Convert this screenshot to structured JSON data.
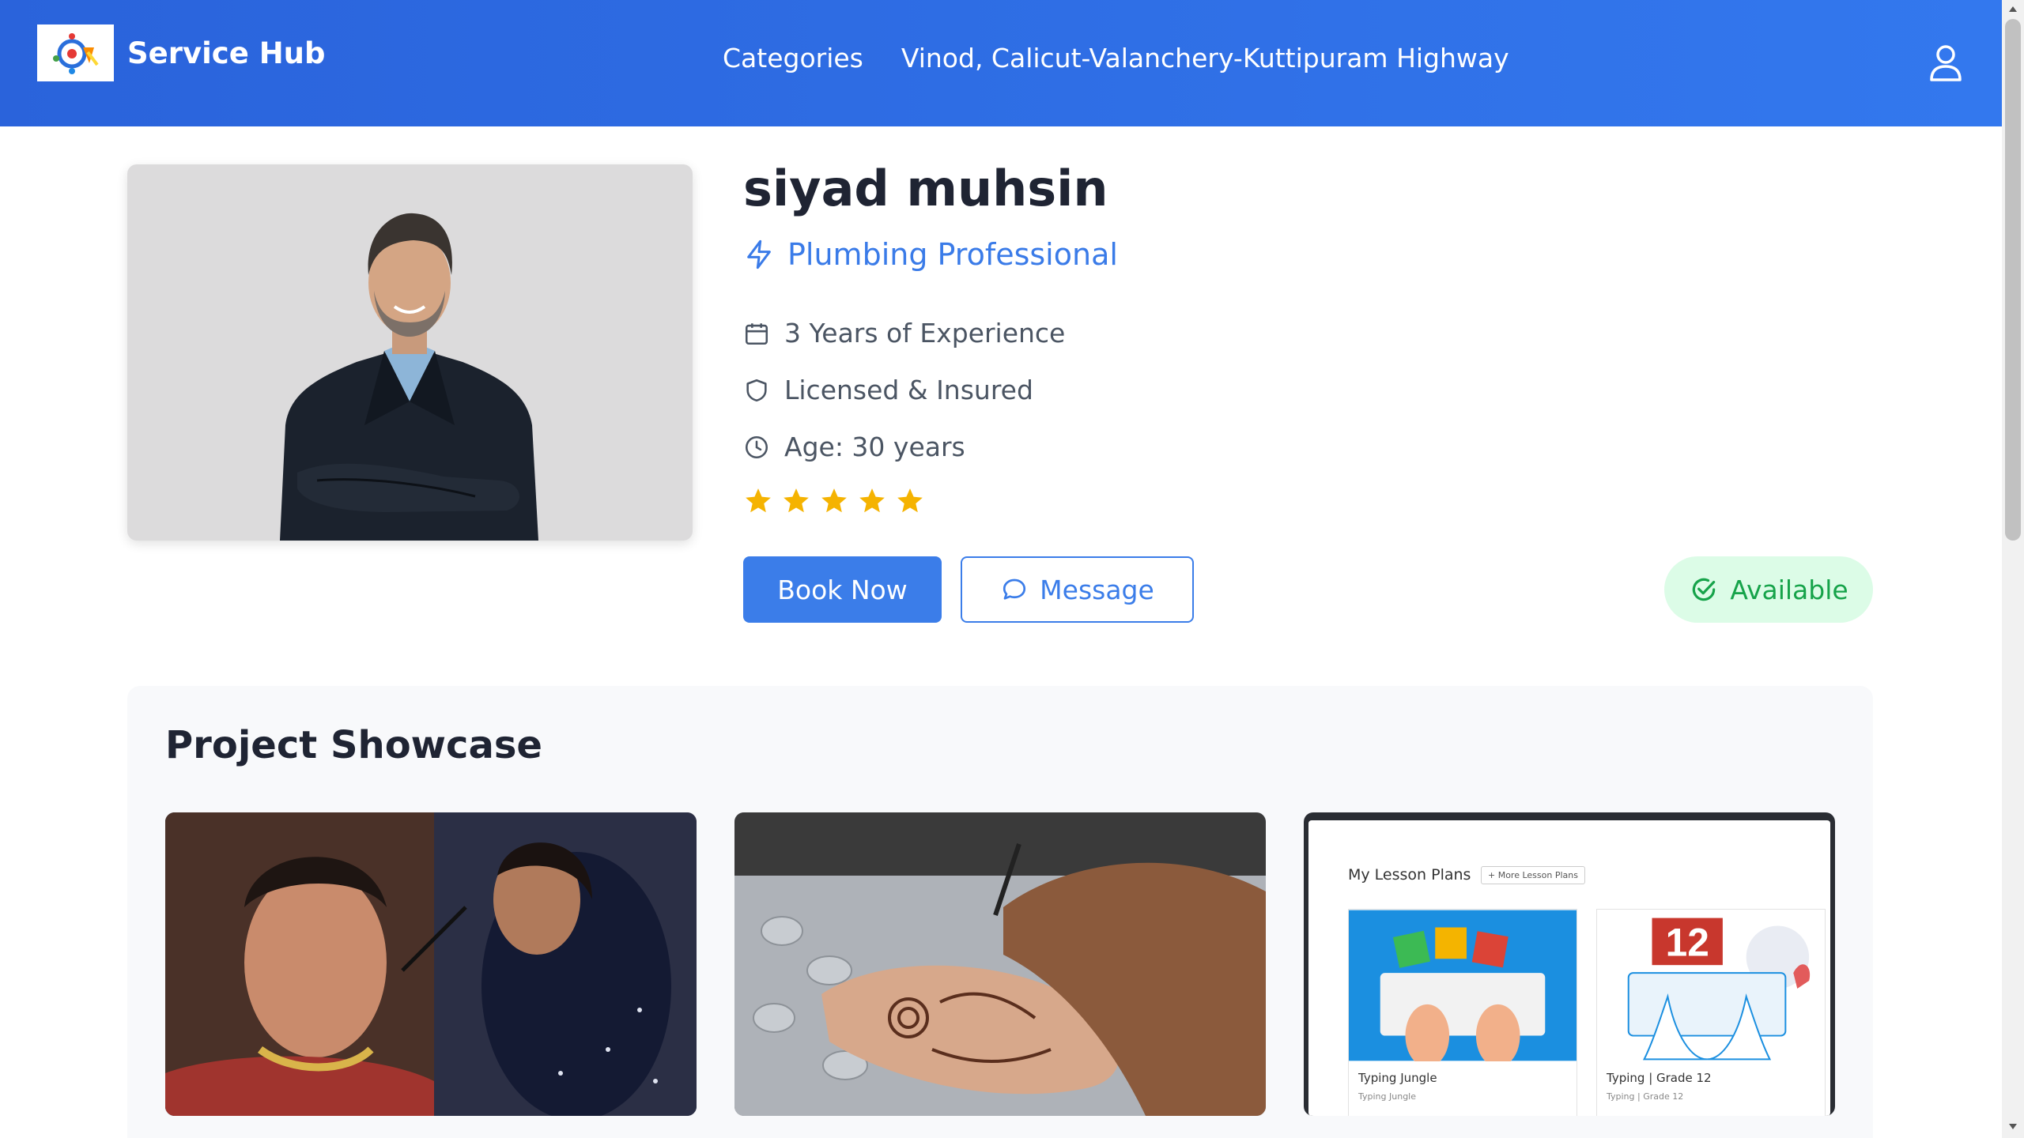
{
  "header": {
    "brand": "Service Hub",
    "nav": [
      "Categories",
      "Vinod, Calicut-Valanchery-Kuttipuram Highway"
    ]
  },
  "profile": {
    "name": "siyad muhsin",
    "profession": "Plumbing Professional",
    "experience": "3 Years of Experience",
    "license": "Licensed & Insured",
    "age": "Age: 30 years",
    "rating": 5,
    "book_label": "Book Now",
    "message_label": "Message",
    "status": "Available"
  },
  "showcase": {
    "title": "Project Showcase",
    "lesson_plans": {
      "title": "My Lesson Plans",
      "more_button": "+ More Lesson Plans",
      "tiles": [
        {
          "name": "Typing Jungle",
          "sub": "Typing Jungle"
        },
        {
          "name": "Typing | Grade 12",
          "sub": "Typing | Grade 12",
          "badge": "12"
        }
      ]
    }
  },
  "colors": {
    "primary": "#3b7de9",
    "header_start": "#2a63db",
    "header_end": "#3378ee",
    "star": "#f5b301",
    "available_bg": "#dcfce7",
    "available_text": "#16a34a"
  },
  "icons": {
    "profession": "lightning-icon",
    "experience": "calendar-icon",
    "license": "shield-icon",
    "age": "clock-icon",
    "message": "chat-bubble-icon",
    "status": "check-circle-icon",
    "user": "user-icon"
  }
}
